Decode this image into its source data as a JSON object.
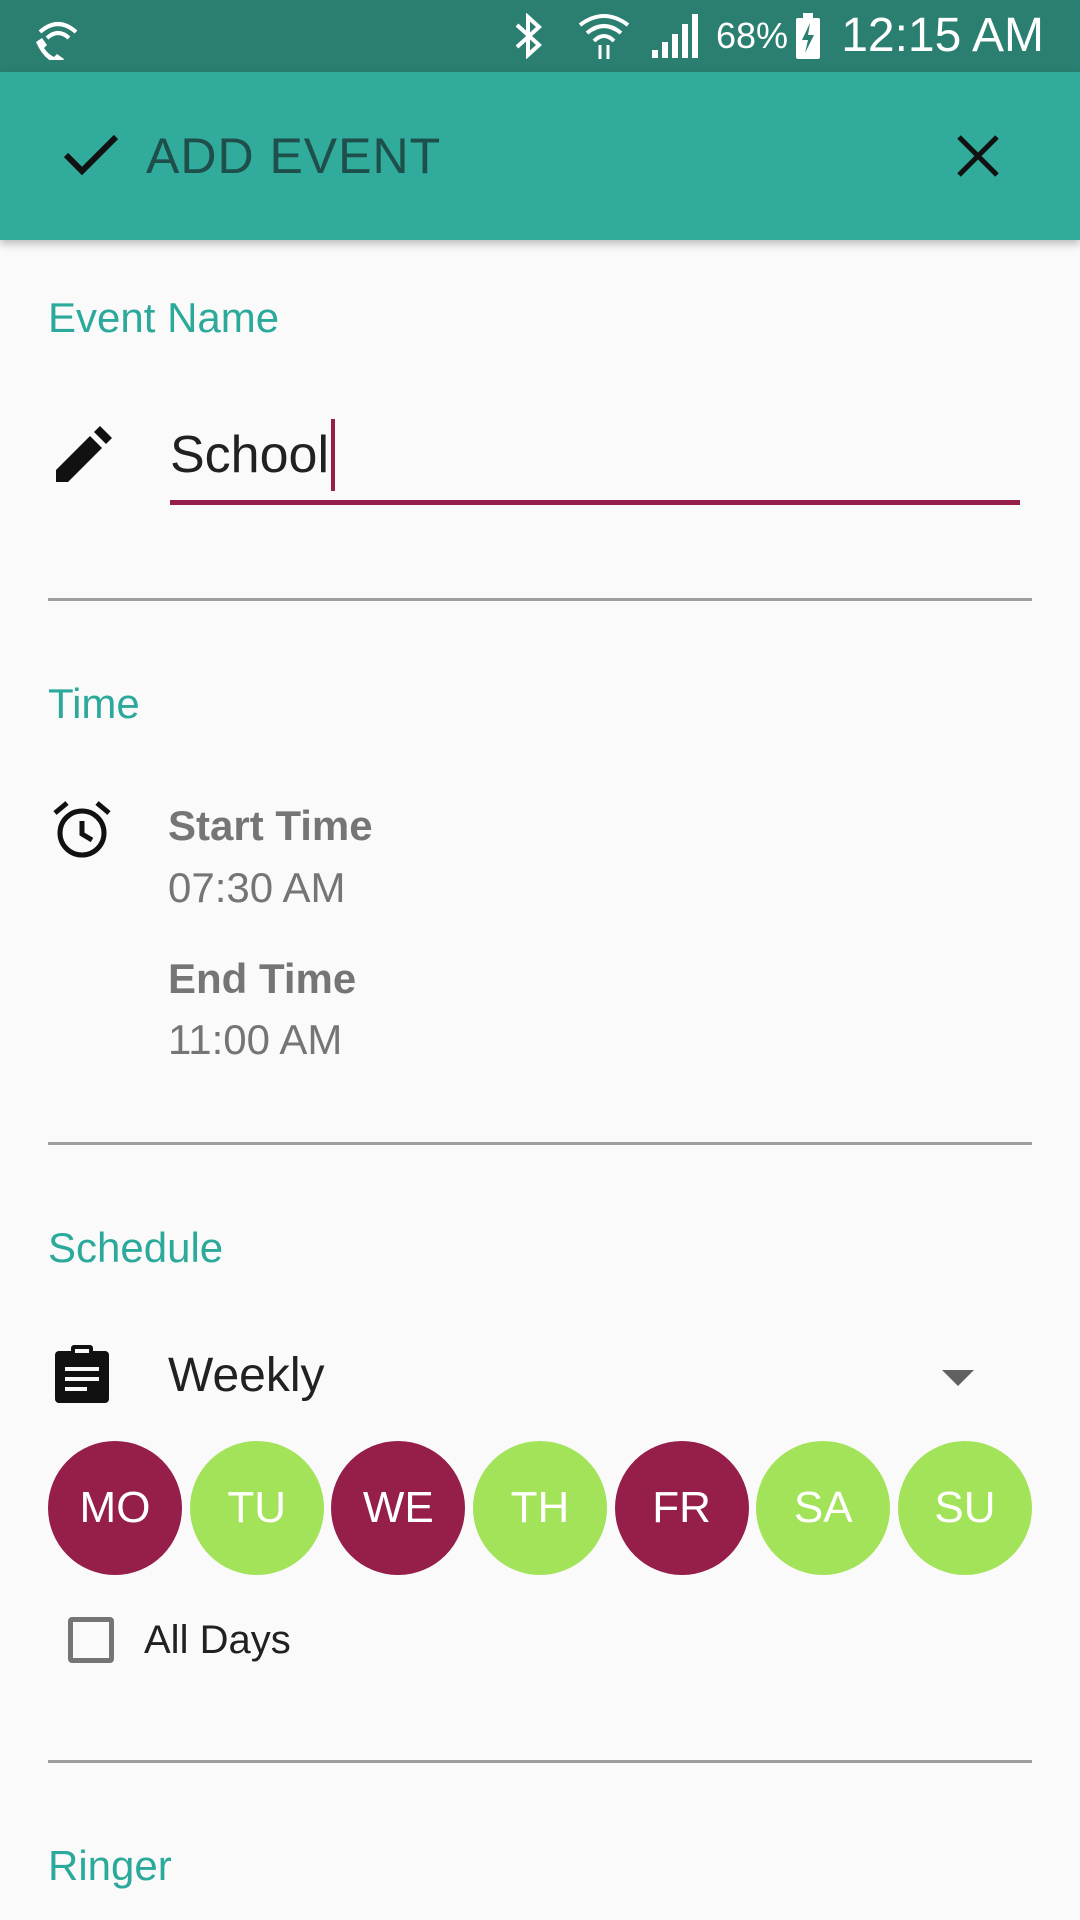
{
  "status_bar": {
    "battery": "68%",
    "time": "12:15 AM",
    "icons": [
      "wifi-calling-icon",
      "bluetooth-icon",
      "wifi-icon",
      "signal-icon",
      "battery-charging-icon"
    ]
  },
  "app_bar": {
    "title": "ADD EVENT",
    "confirm_icon": "check-icon",
    "close_icon": "close-icon"
  },
  "event_name": {
    "section_label": "Event Name",
    "value": "School",
    "icon": "pencil-icon"
  },
  "time": {
    "section_label": "Time",
    "icon": "alarm-icon",
    "start_label": "Start Time",
    "start_value": "07:30 AM",
    "end_label": "End Time",
    "end_value": "11:00 AM"
  },
  "schedule": {
    "section_label": "Schedule",
    "icon": "clipboard-icon",
    "repeat": "Weekly",
    "days": [
      {
        "label": "MO",
        "selected": true
      },
      {
        "label": "TU",
        "selected": false
      },
      {
        "label": "WE",
        "selected": true
      },
      {
        "label": "TH",
        "selected": false
      },
      {
        "label": "FR",
        "selected": true
      },
      {
        "label": "SA",
        "selected": false
      },
      {
        "label": "SU",
        "selected": false
      }
    ],
    "all_days_label": "All Days",
    "all_days_checked": false
  },
  "ringer": {
    "section_label": "Ringer"
  },
  "colors": {
    "status_bar": "#2A7F70",
    "app_bar": "#30AB9C",
    "accent_teal": "#2BA99A",
    "selected_day": "#951E4A",
    "unselected_day": "#A3E35A"
  }
}
